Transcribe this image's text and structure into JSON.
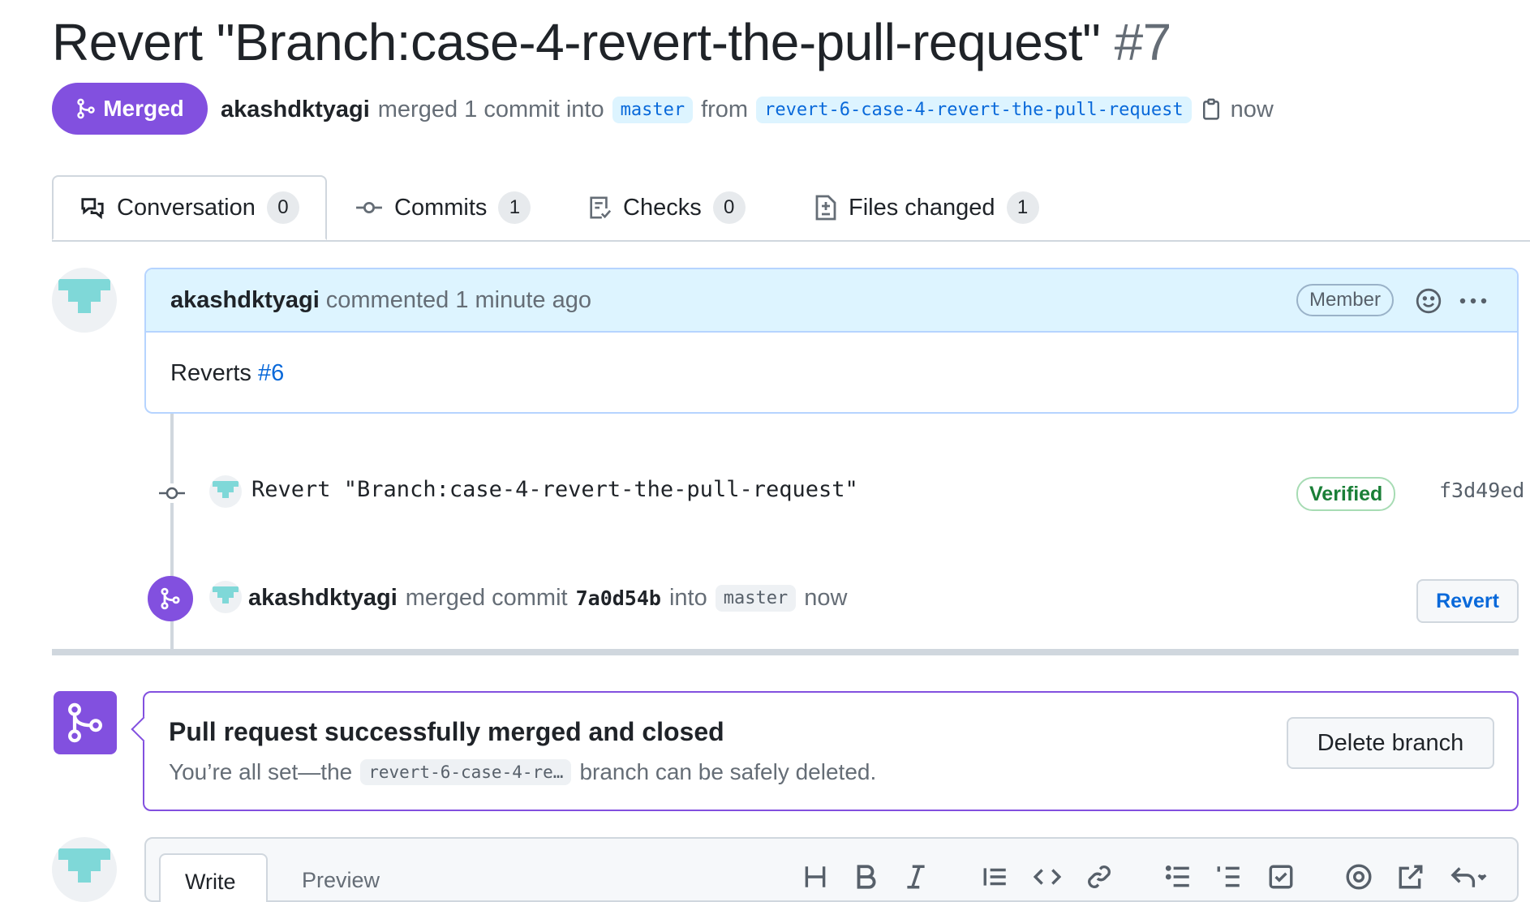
{
  "pr": {
    "title": "Revert \"Branch:case-4-revert-the-pull-request\"",
    "number": "#7",
    "state": "Merged",
    "author": "akashdktyagi",
    "merged_text": "merged 1 commit into",
    "base_branch": "master",
    "from_text": "from",
    "head_branch": "revert-6-case-4-revert-the-pull-request",
    "time": "now"
  },
  "tabs": [
    {
      "label": "Conversation",
      "count": "0",
      "icon": "comment-discussion-icon"
    },
    {
      "label": "Commits",
      "count": "1",
      "icon": "git-commit-icon"
    },
    {
      "label": "Checks",
      "count": "0",
      "icon": "checklist-icon"
    },
    {
      "label": "Files changed",
      "count": "1",
      "icon": "file-diff-icon"
    }
  ],
  "comment": {
    "author": "akashdktyagi",
    "meta": "commented 1 minute ago",
    "role_badge": "Member",
    "body_prefix": "Reverts",
    "body_link": "#6"
  },
  "commit": {
    "message": "Revert \"Branch:case-4-revert-the-pull-request\"",
    "verified": "Verified",
    "sha": "f3d49ed"
  },
  "merge_event": {
    "author": "akashdktyagi",
    "text": "merged commit",
    "sha": "7a0d54b",
    "into": "into",
    "branch": "master",
    "time": "now",
    "revert_label": "Revert"
  },
  "merged_panel": {
    "title": "Pull request successfully merged and closed",
    "sub_prefix": "You’re all set—the",
    "branch_short": "revert-6-case-4-re…",
    "sub_suffix": "branch can be safely deleted.",
    "delete_label": "Delete branch"
  },
  "editor": {
    "write_tab": "Write",
    "preview_tab": "Preview"
  },
  "colors": {
    "merged_purple": "#8250df",
    "link_blue": "#0969da",
    "verified_green": "#1a7f37"
  }
}
